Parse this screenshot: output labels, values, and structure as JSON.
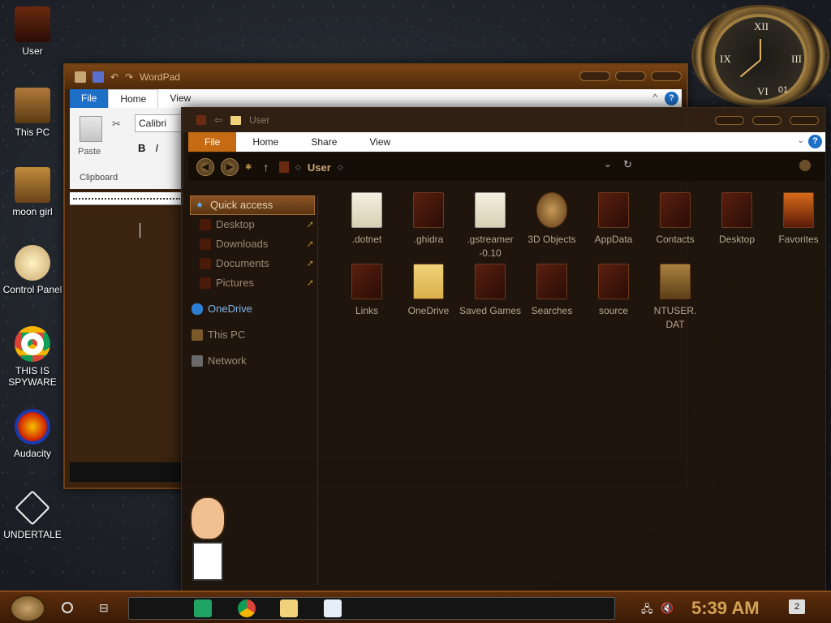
{
  "desktop": {
    "icons": [
      {
        "label": "User"
      },
      {
        "label": "This PC"
      },
      {
        "label": "moon girl"
      },
      {
        "label": "Control Panel"
      },
      {
        "label": "THIS IS SPYWARE"
      },
      {
        "label": "Audacity"
      },
      {
        "label": "UNDERTALE"
      }
    ]
  },
  "clock_widget": {
    "numerals": [
      "XII",
      "III",
      "IX",
      "VI"
    ],
    "date": "01"
  },
  "wordpad": {
    "title": "WordPad",
    "tabs": [
      "File",
      "Home",
      "View"
    ],
    "help_label": "?",
    "collapse_label": "^",
    "paste_label": "Paste",
    "clipboard_label": "Clipboard",
    "font_name": "Calibri",
    "bold_label": "B",
    "italic_label": "I"
  },
  "explorer": {
    "title": "User",
    "tabs": [
      "File",
      "Home",
      "Share",
      "View"
    ],
    "help_label": "?",
    "collapse_label": "⌄",
    "address_crumb": "User",
    "nav_pane": {
      "quick_access": "Quick access",
      "pinned": [
        "Desktop",
        "Downloads",
        "Documents",
        "Pictures"
      ],
      "others": [
        "OneDrive",
        "This PC",
        "Network"
      ]
    },
    "files_row1": [
      {
        "name": ".dotnet"
      },
      {
        "name": ".ghidra"
      },
      {
        "name": ".gstreamer -0.10"
      },
      {
        "name": "3D Objects"
      },
      {
        "name": "AppData"
      },
      {
        "name": "Contacts"
      },
      {
        "name": "Desktop"
      },
      {
        "name": "Favorites"
      }
    ],
    "files_row2": [
      {
        "name": "Links"
      },
      {
        "name": "OneDrive"
      },
      {
        "name": "Saved Games"
      },
      {
        "name": "Searches"
      },
      {
        "name": "source"
      },
      {
        "name": "NTUSER. DAT"
      }
    ]
  },
  "taskbar": {
    "time": "5:39 AM",
    "notification_count": "2"
  },
  "colors": {
    "file_tab_orange": "#c66b14",
    "file_tab_blue": "#1d6fc8",
    "clock_gold": "#d4a255"
  }
}
